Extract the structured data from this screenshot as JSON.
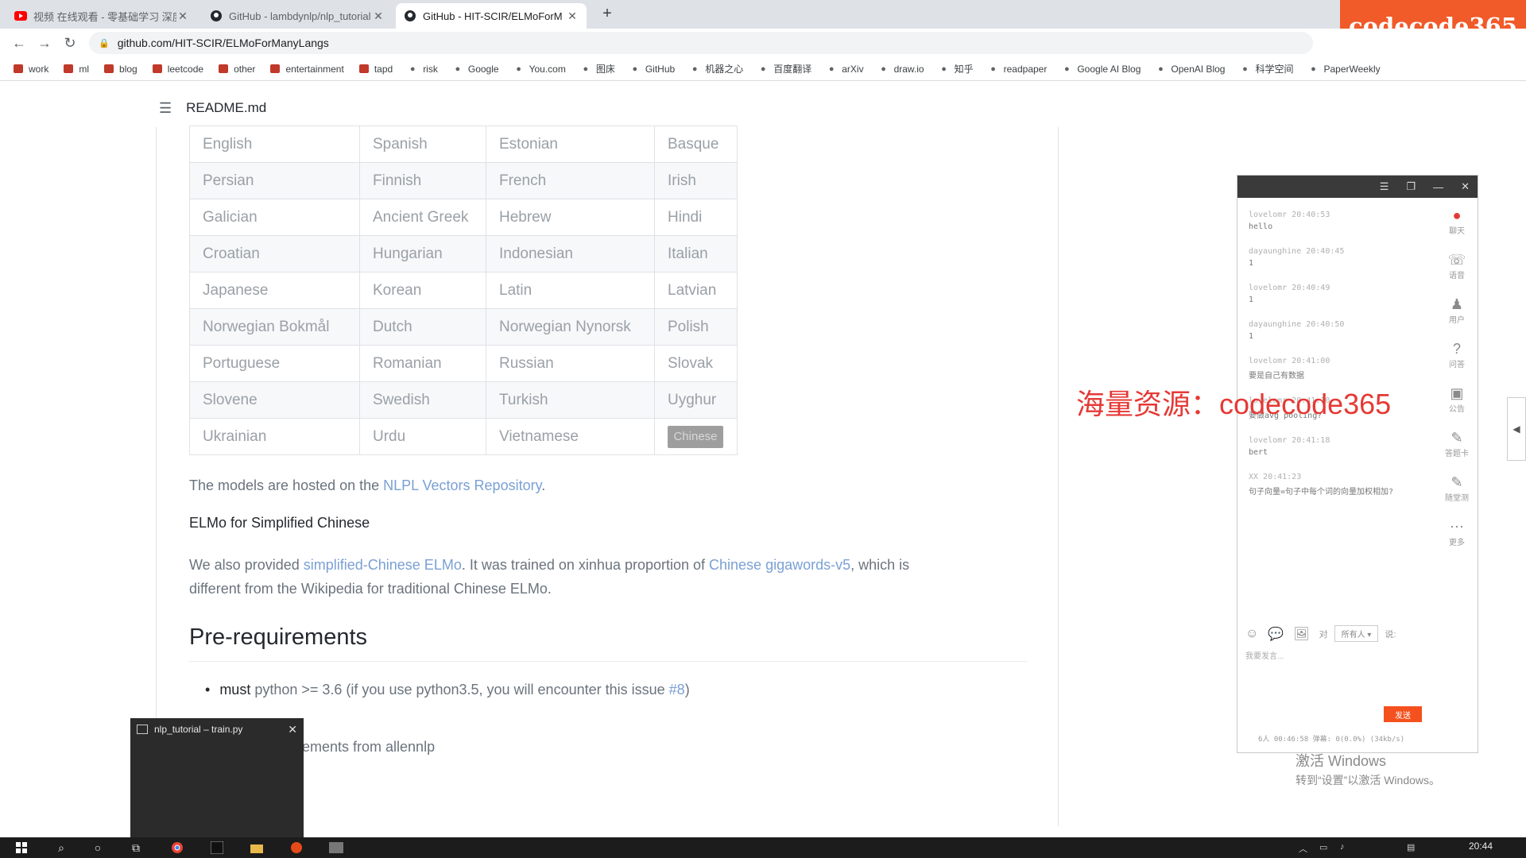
{
  "browser": {
    "tabs": [
      {
        "title": "视频 在线观看 - 零基础学习 深度学习",
        "icon": "youtube-icon",
        "active": false
      },
      {
        "title": "GitHub - lambdynlp/nlp_tutorial",
        "icon": "github-icon",
        "active": false
      },
      {
        "title": "GitHub - HIT-SCIR/ELMoForM",
        "icon": "github-icon",
        "active": true
      }
    ],
    "url": "github.com/HIT-SCIR/ELMoForManyLangs",
    "brand_overlay": "codecode365",
    "bookmarks": [
      {
        "label": "work",
        "icon": "folder-icon"
      },
      {
        "label": "ml",
        "icon": "folder-icon"
      },
      {
        "label": "blog",
        "icon": "folder-icon"
      },
      {
        "label": "leetcode",
        "icon": "folder-icon"
      },
      {
        "label": "other",
        "icon": "folder-icon"
      },
      {
        "label": "entertainment",
        "icon": "folder-icon"
      },
      {
        "label": "tapd",
        "icon": "folder-icon"
      },
      {
        "label": "risk",
        "icon": "risk-icon"
      },
      {
        "label": "Google",
        "icon": "google-icon"
      },
      {
        "label": "You.com",
        "icon": "youcom-icon"
      },
      {
        "label": "图床",
        "icon": "gear-icon"
      },
      {
        "label": "GitHub",
        "icon": "github-icon"
      },
      {
        "label": "机器之心",
        "icon": "jiqizhixin-icon"
      },
      {
        "label": "百度翻译",
        "icon": "translate-icon"
      },
      {
        "label": "arXiv",
        "icon": "arxiv-icon"
      },
      {
        "label": "draw.io",
        "icon": "drawio-icon"
      },
      {
        "label": "知乎",
        "icon": "zhihu-icon"
      },
      {
        "label": "readpaper",
        "icon": "readpaper-icon"
      },
      {
        "label": "Google AI Blog",
        "icon": "google-ai-icon"
      },
      {
        "label": "OpenAI Blog",
        "icon": "openai-icon"
      },
      {
        "label": "科学空间",
        "icon": "science-space-icon"
      },
      {
        "label": "PaperWeekly",
        "icon": "paperweekly-icon"
      }
    ]
  },
  "readme": {
    "filename": "README.md",
    "languages": [
      [
        "English",
        "Spanish",
        "Estonian",
        "Basque"
      ],
      [
        "Persian",
        "Finnish",
        "French",
        "Irish"
      ],
      [
        "Galician",
        "Ancient Greek",
        "Hebrew",
        "Hindi"
      ],
      [
        "Croatian",
        "Hungarian",
        "Indonesian",
        "Italian"
      ],
      [
        "Japanese",
        "Korean",
        "Latin",
        "Latvian"
      ],
      [
        "Norwegian Bokmål",
        "Dutch",
        "Norwegian Nynorsk",
        "Polish"
      ],
      [
        "Portuguese",
        "Romanian",
        "Russian",
        "Slovak"
      ],
      [
        "Slovene",
        "Swedish",
        "Turkish",
        "Uyghur"
      ],
      [
        "Ukrainian",
        "Urdu",
        "Vietnamese",
        "Chinese"
      ]
    ],
    "hosted": {
      "before": "The models are hosted on the ",
      "link": "NLPL Vectors Repository",
      "after": "."
    },
    "elmo_heading": "ELMo for Simplified Chinese",
    "elmo_para": {
      "p1": "We also provided ",
      "link1": "simplified-Chinese ELMo",
      "p2": ". It was trained on xinhua proportion of ",
      "link2": "Chinese gigawords-v5",
      "p3": ", which is",
      "line2": "different from the Wikipedia for traditional Chinese ELMo."
    },
    "prereq_heading": "Pre-requirements",
    "bullet1": {
      "bold": "must",
      "text": " python >= 3.6 (if you use python3.5, you will encounter this issue ",
      "link": "#8",
      "end": ")"
    },
    "bullet_partial": "ements from allennlp"
  },
  "chat": {
    "messages": [
      {
        "who": "lovelomr 20:40:53",
        "text": "hello"
      },
      {
        "who": "dayaunghine 20:40:45",
        "text": "1"
      },
      {
        "who": "lovelomr 20:40:49",
        "text": "1"
      },
      {
        "who": "dayaunghine 20:40:50",
        "text": "1"
      },
      {
        "who": "lovelomr 20:41:00",
        "text": "要是自己有数据"
      },
      {
        "who": "lovelomr 20:41:10",
        "text": "要做avg pooling?"
      },
      {
        "who": "lovelomr 20:41:18",
        "text": "bert"
      },
      {
        "who": "XX 20:41:23",
        "text": "句子向量=句子中每个词的向量加权相加?"
      }
    ],
    "side": [
      {
        "label": "聊天",
        "icon": "chat-icon"
      },
      {
        "label": "语音",
        "icon": "phone-icon"
      },
      {
        "label": "用户",
        "icon": "user-icon"
      },
      {
        "label": "问答",
        "icon": "qa-icon"
      },
      {
        "label": "公告",
        "icon": "notice-icon"
      },
      {
        "label": "答题卡",
        "icon": "answer-card-icon"
      },
      {
        "label": "随堂测",
        "icon": "quiz-icon"
      },
      {
        "label": "更多",
        "icon": "more-icon"
      }
    ],
    "to_label": "对",
    "recipient": "所有人",
    "say_label": "说:",
    "input_placeholder": "我要发言...",
    "send": "发送",
    "status": "6人  00:46:58  弹幕: 0(0.0%) (34kb/s)"
  },
  "overlays": {
    "watermark": "海量资源：codecode365",
    "activate_title": "激活 Windows",
    "activate_sub": "转到“设置”以激活 Windows。"
  },
  "preview": {
    "title": "nlp_tutorial – train.py"
  },
  "taskbar": {
    "time": "20:44"
  }
}
